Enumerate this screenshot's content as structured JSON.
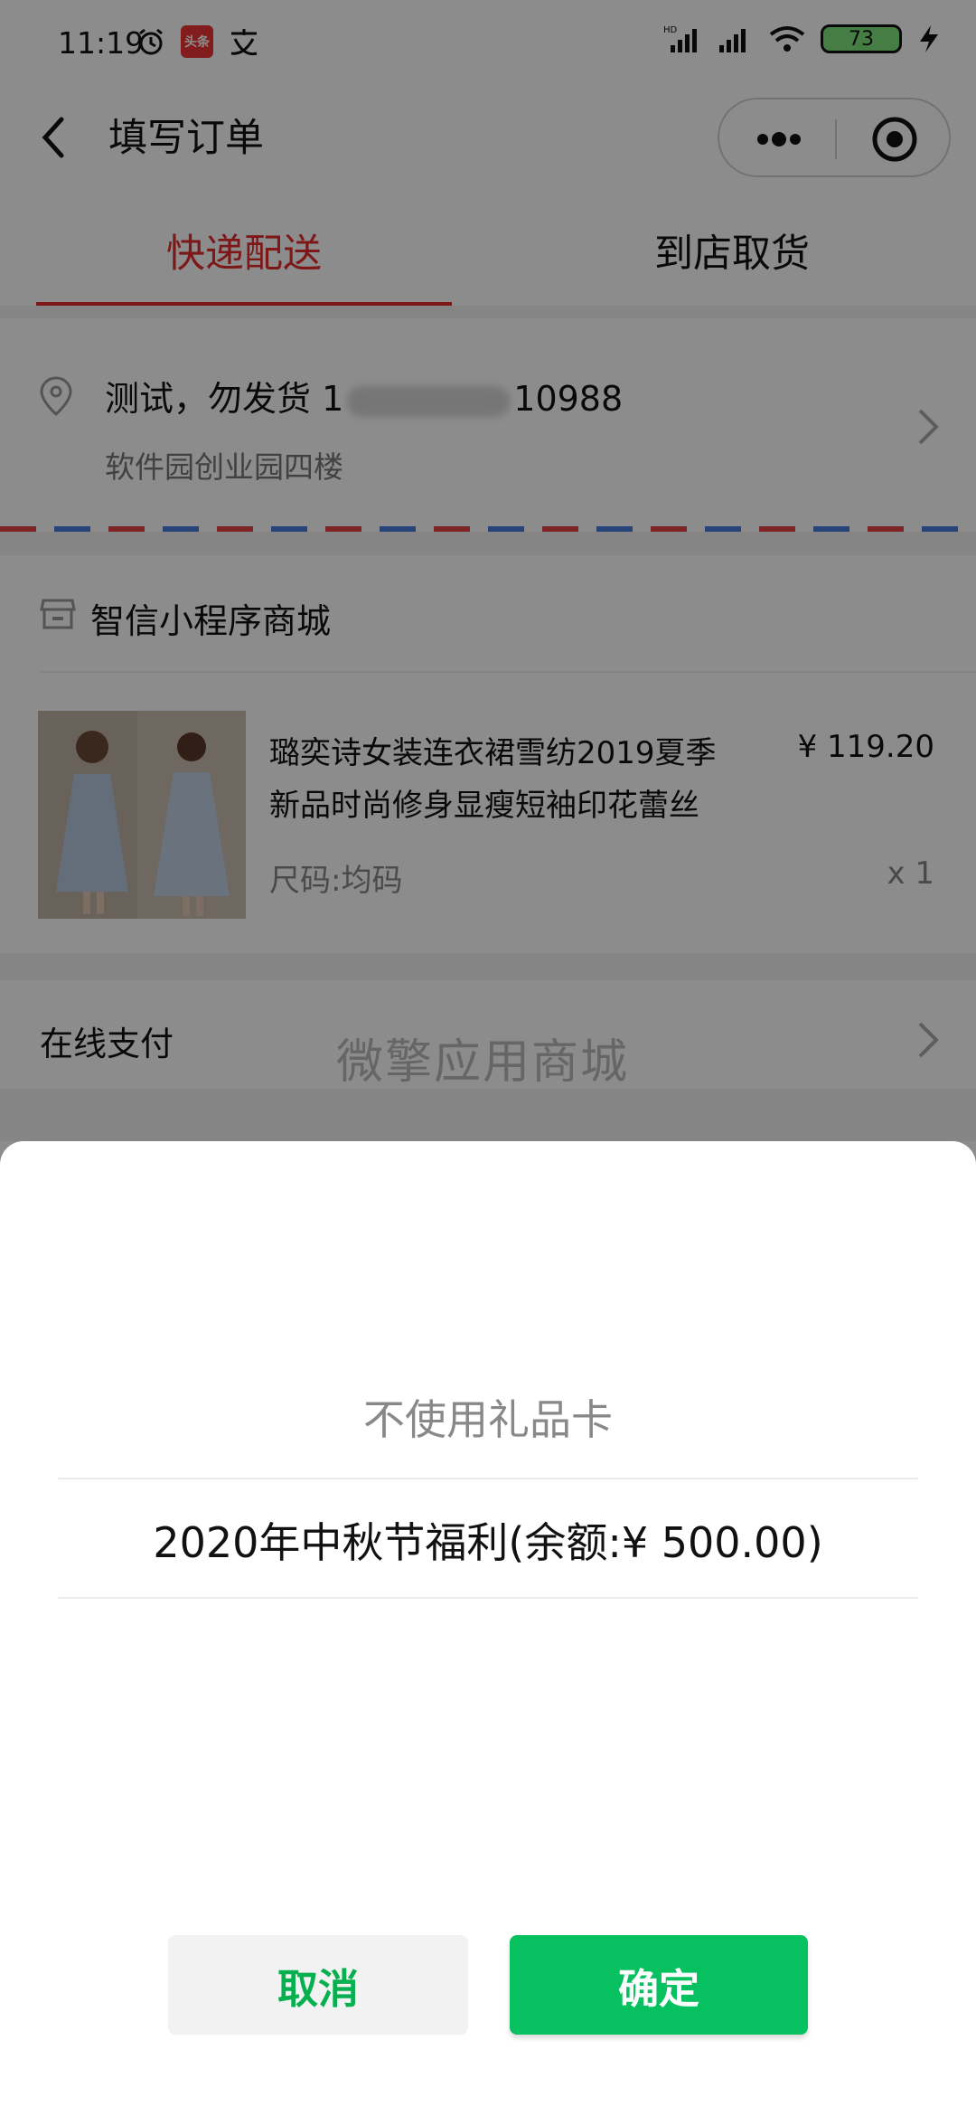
{
  "status_bar": {
    "time": "11:19",
    "app_badge": "头条",
    "battery": "73"
  },
  "nav": {
    "title": "填写订单"
  },
  "tabs": [
    {
      "label": "快递配送",
      "active": true
    },
    {
      "label": "到店取货",
      "active": false
    }
  ],
  "address": {
    "name_prefix": "测试，勿发货 1",
    "name_suffix": "10988",
    "detail": "软件园创业园四楼"
  },
  "shop": {
    "name": "智信小程序商城"
  },
  "product": {
    "title": "璐奕诗女装连衣裙雪纺2019夏季新品时尚修身显瘦短袖印花蕾丝",
    "price": "¥ 119.20",
    "size": "尺码:均码",
    "quantity": "x 1"
  },
  "payment": {
    "label": "在线支付"
  },
  "watermark": "微擎应用商城",
  "sheet": {
    "options": [
      "不使用礼品卡",
      "2020年中秋节福利(余额:¥ 500.00)"
    ],
    "cancel_label": "取消",
    "confirm_label": "确定"
  },
  "colors": {
    "accent": "#e52c2c",
    "confirm": "#07c160"
  }
}
